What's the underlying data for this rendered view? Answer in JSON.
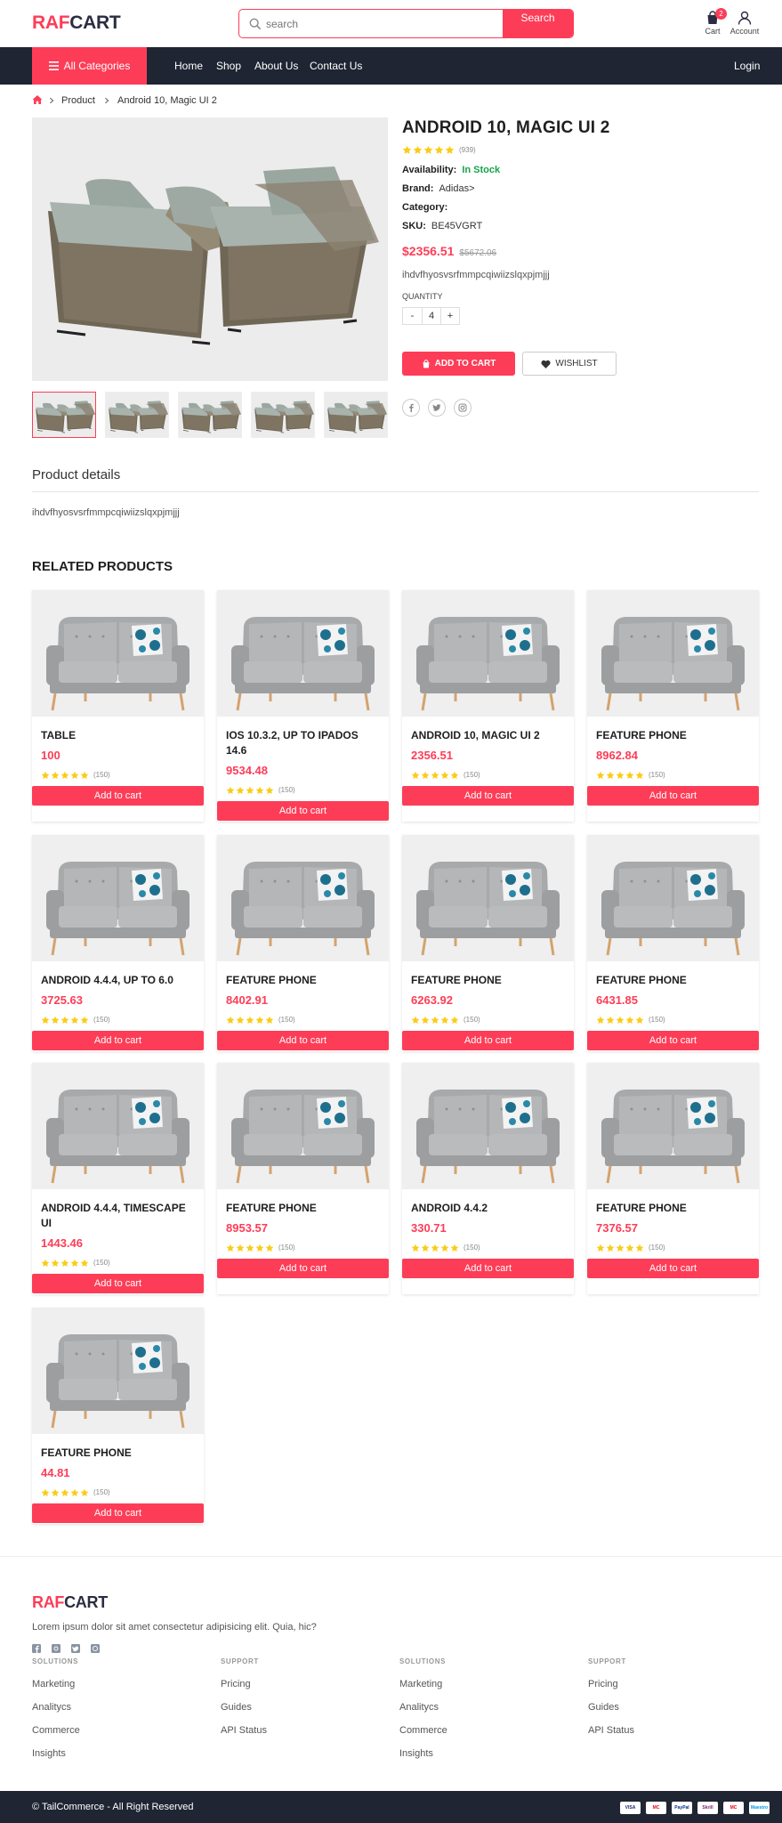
{
  "header": {
    "logo_a": "RAF",
    "logo_b": "CART",
    "search_placeholder": "search",
    "search_button": "Search",
    "cart_label": "Cart",
    "cart_count": "2",
    "account_label": "Account"
  },
  "nav": {
    "all_categories": "All Categories",
    "links": [
      "Home",
      "Shop",
      "About Us",
      "Contact Us"
    ],
    "login": "Login"
  },
  "breadcrumb": [
    "Product",
    "Android 10, Magic UI 2"
  ],
  "product": {
    "title": "ANDROID 10, MAGIC UI 2",
    "rating_count": "(939)",
    "availability_label": "Availability:",
    "availability_value": "In Stock",
    "brand_label": "Brand:",
    "brand_value": "Adidas>",
    "category_label": "Category:",
    "sku_label": "SKU:",
    "sku_value": "BE45VGRT",
    "price": "$2356.51",
    "old_price": "$5672.06",
    "description": "ihdvfhyosvsrfmmpcqiwiizslqxpjmjjj",
    "quantity_label": "QUANTITY",
    "quantity_minus": "-",
    "quantity_value": "4",
    "quantity_plus": "+",
    "add_to_cart": "ADD TO CART",
    "wishlist": "WISHLIST"
  },
  "details": {
    "heading": "Product details",
    "text": "ihdvfhyosvsrfmmpcqiwiizslqxpjmjjj"
  },
  "related": {
    "heading": "RELATED PRODUCTS",
    "add_label": "Add to cart",
    "rating_count": "(150)",
    "items": [
      {
        "name": "TABLE",
        "price": "100"
      },
      {
        "name": "IOS 10.3.2, UP TO IPADOS 14.6",
        "price": "9534.48"
      },
      {
        "name": "ANDROID 10, MAGIC UI 2",
        "price": "2356.51"
      },
      {
        "name": "FEATURE PHONE",
        "price": "8962.84"
      },
      {
        "name": "ANDROID 4.4.4, UP TO 6.0",
        "price": "3725.63"
      },
      {
        "name": "FEATURE PHONE",
        "price": "8402.91"
      },
      {
        "name": "FEATURE PHONE",
        "price": "6263.92"
      },
      {
        "name": "FEATURE PHONE",
        "price": "6431.85"
      },
      {
        "name": "ANDROID 4.4.4, TIMESCAPE UI",
        "price": "1443.46"
      },
      {
        "name": "FEATURE PHONE",
        "price": "8953.57"
      },
      {
        "name": "ANDROID 4.4.2",
        "price": "330.71"
      },
      {
        "name": "FEATURE PHONE",
        "price": "7376.57"
      },
      {
        "name": "FEATURE PHONE",
        "price": "44.81"
      }
    ]
  },
  "footer": {
    "logo_a": "RAF",
    "logo_b": "CART",
    "description": "Lorem ipsum dolor sit amet consectetur adipisicing elit. Quia, hic?",
    "columns": [
      {
        "heading": "SOLUTIONS",
        "links": [
          "Marketing",
          "Analitycs",
          "Commerce",
          "Insights"
        ]
      },
      {
        "heading": "SUPPORT",
        "links": [
          "Pricing",
          "Guides",
          "API Status"
        ]
      },
      {
        "heading": "SOLUTIONS",
        "links": [
          "Marketing",
          "Analitycs",
          "Commerce",
          "Insights"
        ]
      },
      {
        "heading": "SUPPORT",
        "links": [
          "Pricing",
          "Guides",
          "API Status"
        ]
      }
    ],
    "copyright": "© TailCommerce - All Right Reserved",
    "payments": [
      "VISA",
      "MC",
      "PayPal",
      "Skrill",
      "MC",
      "Maestro"
    ]
  },
  "colors": {
    "accent": "#fd3d57",
    "dark": "#1f2533",
    "star": "#facc15",
    "stock": "#16a34a"
  }
}
